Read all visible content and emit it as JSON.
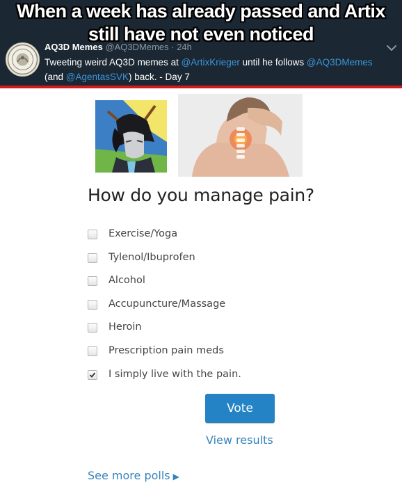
{
  "meme": {
    "caption_line1": "When a week has already passed and Artix",
    "caption_line2": "still have not even noticed"
  },
  "tweet": {
    "display_name": "AQ3D Memes",
    "handle_time": "@AQ3DMemes · 24h",
    "text_1": "Tweeting weird AQ3D memes at ",
    "mention_1": "@ArtixKrieger",
    "text_2": " until he follows ",
    "mention_2": "@AQ3DMemes",
    "text_3": "(and ",
    "mention_3": "@AgentasSVK",
    "text_4": ") back. - Day 7"
  },
  "poll": {
    "question": "How do you manage pain?",
    "options": [
      {
        "label": "Exercise/Yoga",
        "checked": false
      },
      {
        "label": "Tylenol/Ibuprofen",
        "checked": false
      },
      {
        "label": "Alcohol",
        "checked": false
      },
      {
        "label": "Accupuncture/Massage",
        "checked": false
      },
      {
        "label": "Heroin",
        "checked": false
      },
      {
        "label": "Prescription pain meds",
        "checked": false
      },
      {
        "label": "I simply live with the pain.",
        "checked": true
      }
    ],
    "vote_label": "Vote",
    "view_results_label": "View results",
    "see_more_label": "See more polls"
  },
  "colors": {
    "header_bg": "#1b2732",
    "accent_red": "#d01c1c",
    "link_blue": "#3584bd",
    "button_blue": "#2483c4",
    "twitter_link": "#3b94d9"
  }
}
